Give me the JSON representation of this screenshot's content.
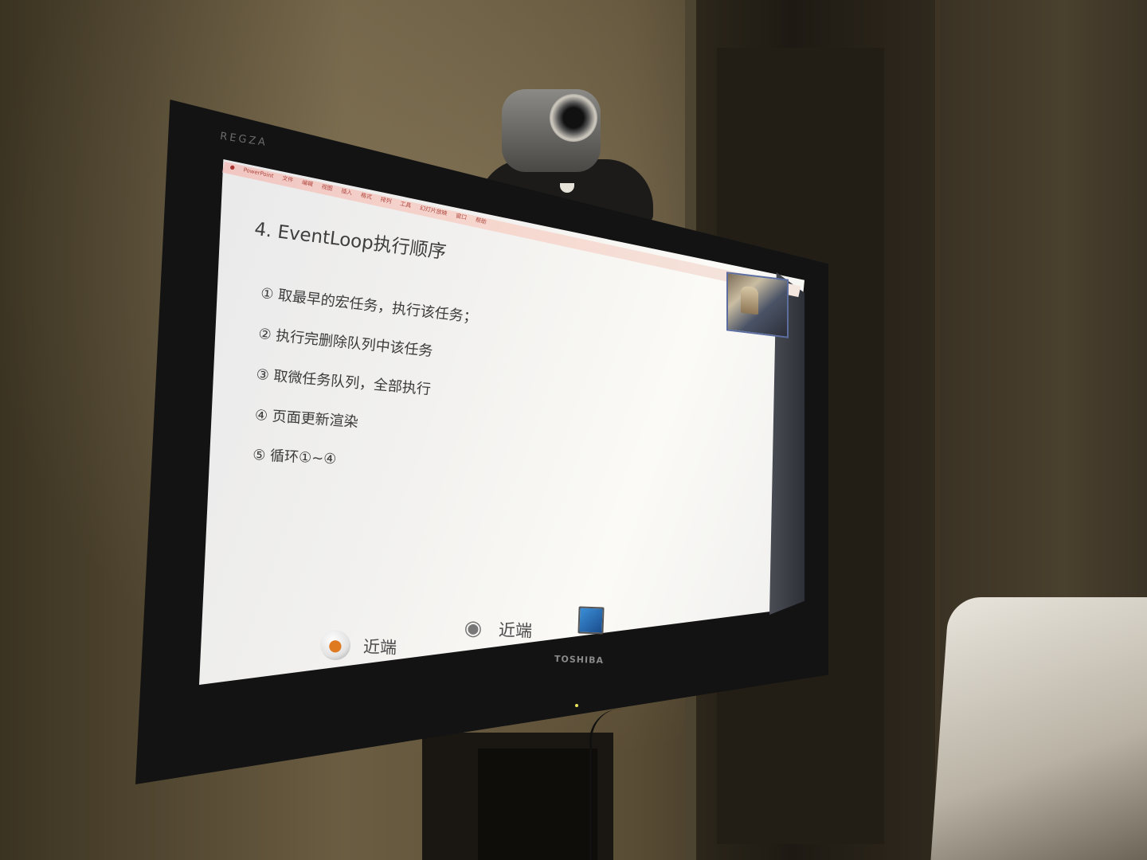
{
  "tv": {
    "brand_label": "REGZA",
    "maker_label": "TOSHIBA"
  },
  "menubar": {
    "app_name": "PowerPoint",
    "items": [
      "文件",
      "编辑",
      "视图",
      "插入",
      "格式",
      "排列",
      "工具",
      "幻灯片放映",
      "窗口",
      "帮助"
    ]
  },
  "slide": {
    "title": "4. EventLoop执行顺序",
    "bullets": [
      "① 取最早的宏任务，执行该任务；",
      "② 执行完删除队列中该任务",
      "③ 取微任务队列，全部执行",
      "④ 页面更新渲染",
      "⑤ 循环①~④"
    ]
  },
  "toolbar": {
    "mic_label": "近端",
    "camera_label": "近端"
  },
  "icons": [
    "mic-icon",
    "camera-icon",
    "laptop-icon"
  ],
  "colors": {
    "menubar_text": "#b0463f",
    "slide_text": "#3a3a3a",
    "mic_accent": "#e07a20"
  }
}
